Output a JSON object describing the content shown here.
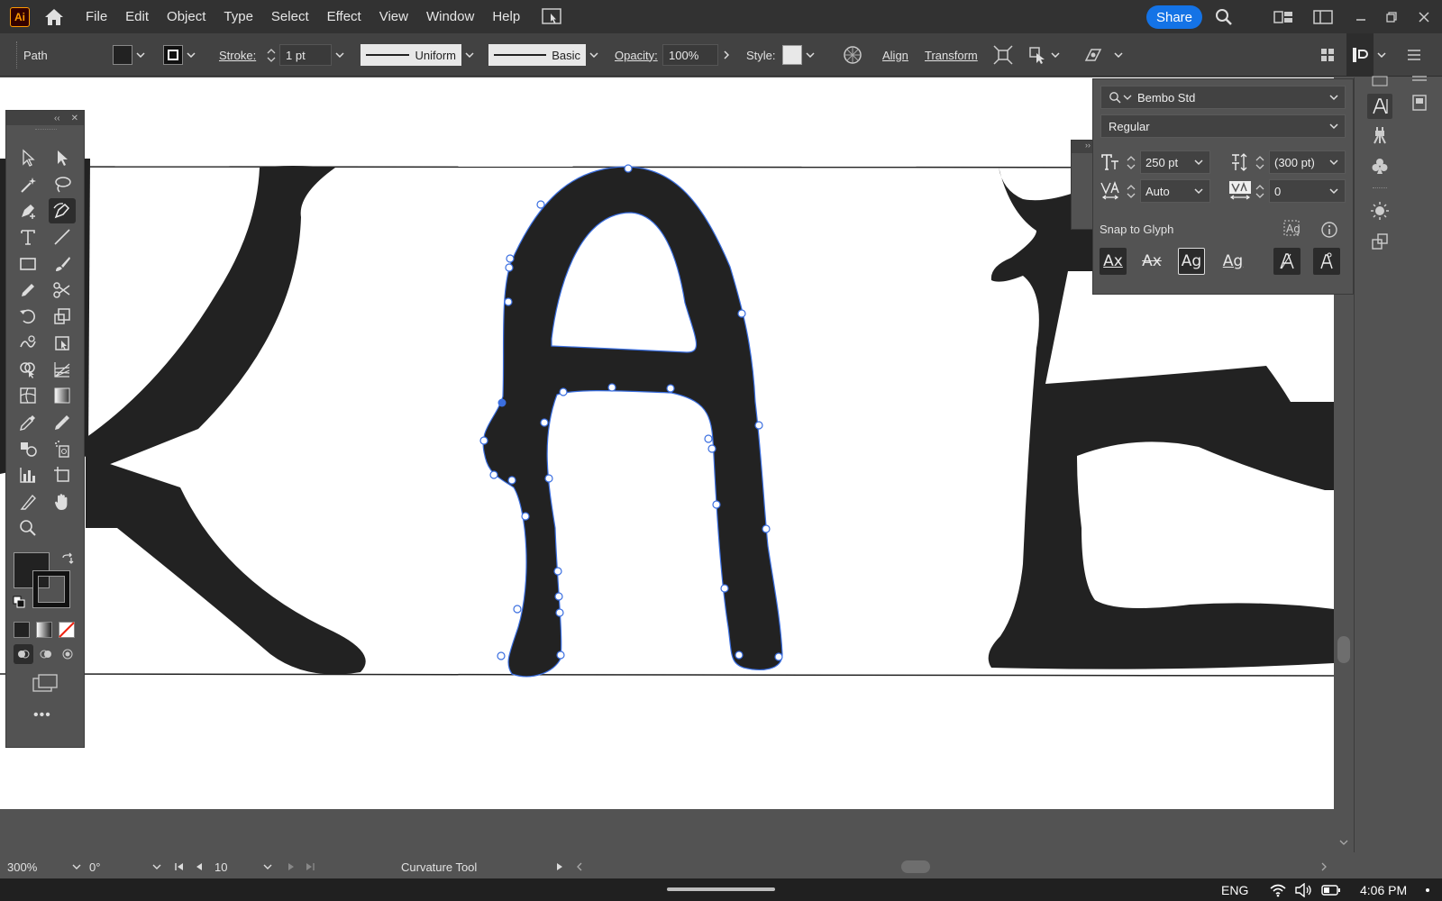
{
  "app": {
    "logo_text": "Ai"
  },
  "menu": {
    "items": [
      "File",
      "Edit",
      "Object",
      "Type",
      "Select",
      "Effect",
      "View",
      "Window",
      "Help"
    ]
  },
  "header": {
    "share_label": "Share"
  },
  "control_bar": {
    "object_type": "Path",
    "fill_color": "#222222",
    "stroke_label": "Stroke:",
    "stroke_weight": "1 pt",
    "variable_width_profile": "Uniform",
    "brush_definition": "Basic",
    "opacity_label": "Opacity:",
    "opacity_value": "100%",
    "style_label": "Style:",
    "align_label": "Align",
    "transform_label": "Transform"
  },
  "character_panel": {
    "font_family": "Bembo Std",
    "font_style": "Regular",
    "font_size": "250 pt",
    "leading": "(300 pt)",
    "kerning": "Auto",
    "tracking": "0",
    "snap_label": "Snap to Glyph",
    "glyph_buttons": [
      "Ax",
      "Ax",
      "Ag",
      "Ag"
    ]
  },
  "status_bar": {
    "zoom": "300%",
    "rotation": "0°",
    "artboard_number": "10",
    "current_tool": "Curvature Tool"
  },
  "taskbar": {
    "language": "ENG",
    "time": "4:06 PM"
  },
  "colors": {
    "accent": "#1473e6",
    "selection": "#3b6fe0",
    "glyph_fill": "#222222"
  }
}
